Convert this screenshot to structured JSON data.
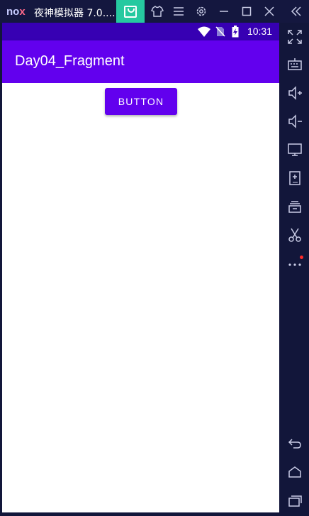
{
  "emulator": {
    "logo_part1": "no",
    "logo_part2": "x",
    "window_title": "夜神模拟器 7.0....",
    "accent_store": "#26c9a0"
  },
  "phone": {
    "status_time": "10:31",
    "app_title": "Day04_Fragment",
    "button_label": "BUTTON",
    "colors": {
      "primary": "#6200ee",
      "primary_dark": "#3700b3"
    }
  },
  "sidebar": {
    "icons": [
      "fullscreen-icon",
      "keyboard-icon",
      "volume-up-icon",
      "volume-down-icon",
      "screen-icon",
      "apk-install-icon",
      "multi-instance-icon",
      "screenshot-cut-icon",
      "more-icon",
      "back-icon",
      "home-icon",
      "recent-apps-icon"
    ]
  }
}
